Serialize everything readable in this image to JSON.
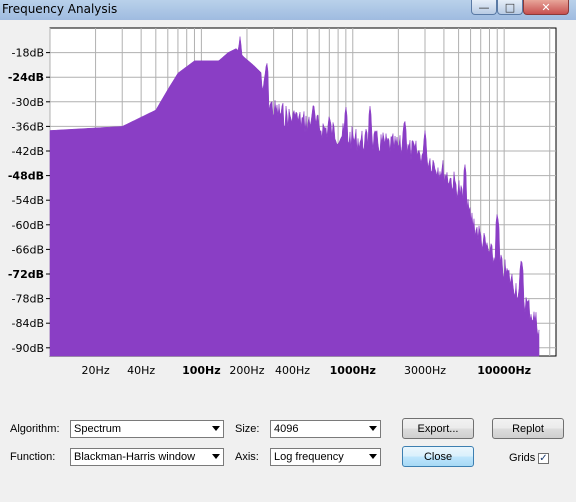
{
  "window": {
    "title": "Frequency Analysis"
  },
  "chart_data": {
    "type": "area",
    "title": "",
    "xlabel": "",
    "ylabel": "",
    "x_scale": "log",
    "xlim": [
      10,
      22000
    ],
    "ylim": [
      -92,
      -12
    ],
    "grid": true,
    "color": "#8a3ec5",
    "y_ticks": [
      "-18dB",
      "-24dB",
      "-30dB",
      "-36dB",
      "-42dB",
      "-48dB",
      "-54dB",
      "-60dB",
      "-66dB",
      "-72dB",
      "-78dB",
      "-84dB",
      "-90dB"
    ],
    "y_tick_values": [
      -18,
      -24,
      -30,
      -36,
      -42,
      -48,
      -54,
      -60,
      -66,
      -72,
      -78,
      -84,
      -90
    ],
    "y_bold": [
      -24,
      -48,
      -72
    ],
    "x_ticks": [
      "20Hz",
      "40Hz",
      "100Hz",
      "200Hz",
      "400Hz",
      "1000Hz",
      "3000Hz",
      "10000Hz"
    ],
    "x_tick_values": [
      20,
      40,
      100,
      200,
      400,
      1000,
      3000,
      10000
    ],
    "x_bold": [
      100,
      1000,
      10000
    ],
    "series": [
      {
        "x": [
          10,
          30,
          50,
          60,
          70,
          90,
          110,
          130,
          150,
          170,
          190,
          220,
          250,
          300,
          400,
          600,
          1000,
          1500,
          2000,
          3000,
          4000,
          5000,
          6000,
          7000,
          8000,
          10000,
          12000,
          15000,
          17000
        ],
        "y": [
          -37,
          -36,
          -32,
          -27,
          -23,
          -20,
          -20,
          -20,
          -18,
          -17,
          -19,
          -21,
          -23,
          -29,
          -31,
          -33,
          -36,
          -37,
          -38,
          -40,
          -44,
          -48,
          -55,
          -60,
          -64,
          -68,
          -72,
          -78,
          -82
        ],
        "peaks": [
          [
            180,
            -14
          ],
          [
            270,
            -20
          ],
          [
            310,
            -33
          ],
          [
            420,
            -32
          ],
          [
            550,
            -30
          ],
          [
            700,
            -33
          ],
          [
            900,
            -31
          ],
          [
            1300,
            -31
          ],
          [
            2200,
            -34
          ],
          [
            3000,
            -37
          ],
          [
            5500,
            -45
          ],
          [
            9000,
            -57
          ],
          [
            13000,
            -68
          ]
        ]
      }
    ]
  },
  "controls": {
    "algorithm_label": "Algorithm:",
    "algorithm_value": "Spectrum",
    "size_label": "Size:",
    "size_value": "4096",
    "function_label": "Function:",
    "function_value": "Blackman-Harris window",
    "axis_label": "Axis:",
    "axis_value": "Log frequency",
    "export_label": "Export...",
    "replot_label": "Replot",
    "close_label": "Close",
    "grids_label": "Grids",
    "grids_checked": true
  }
}
